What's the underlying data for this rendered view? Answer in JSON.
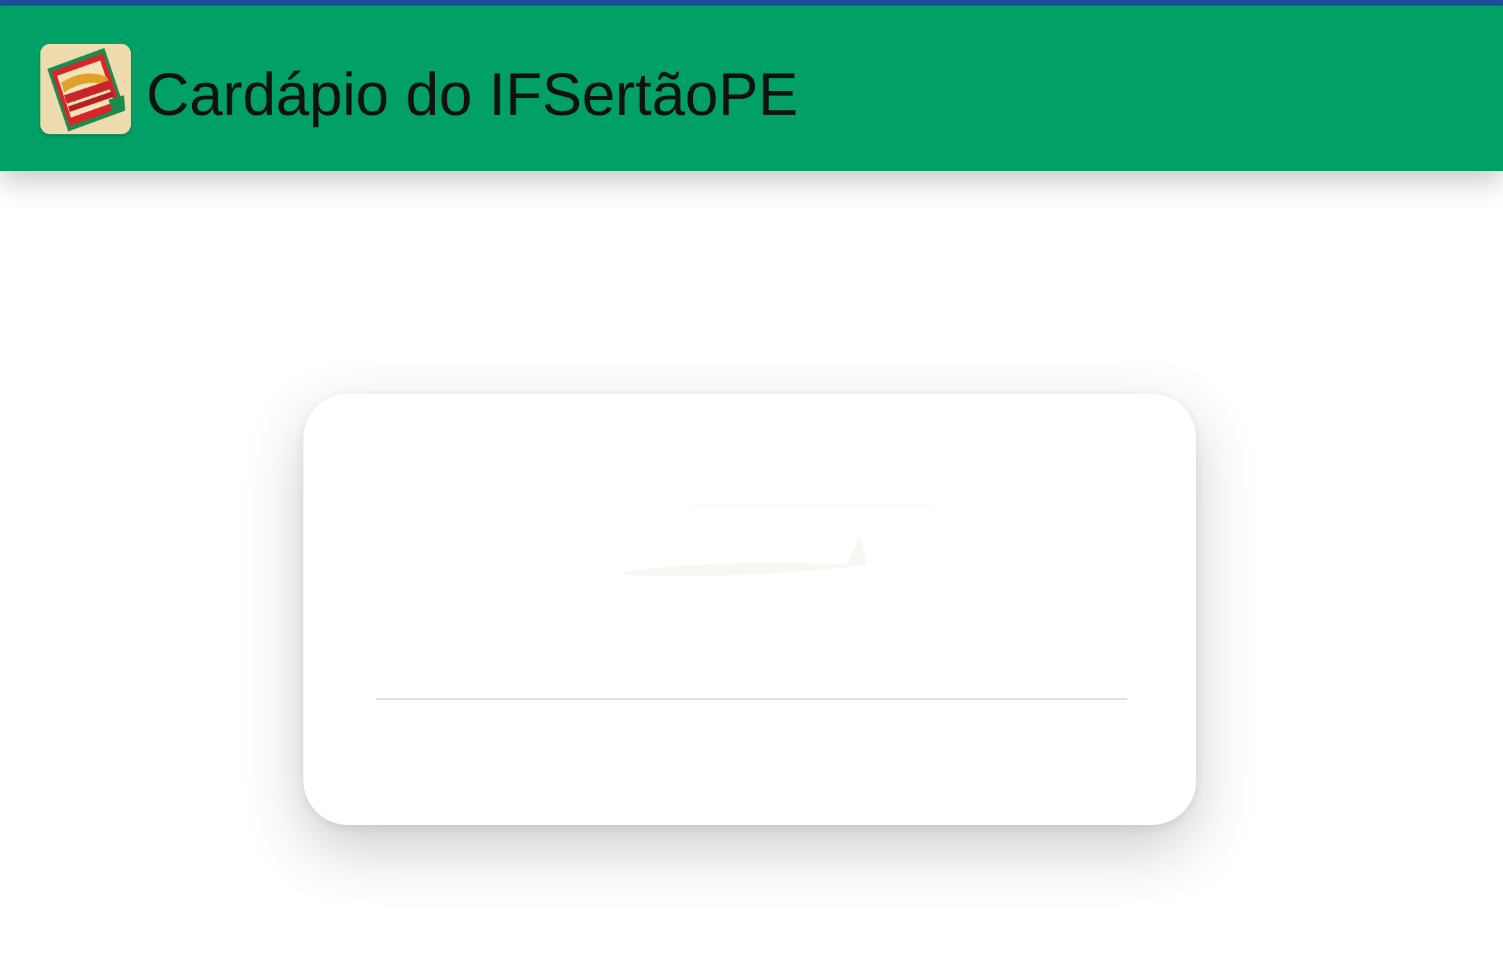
{
  "app_bar": {
    "title": "Cardápio do IFSertãoPE",
    "icon": "cardapio-menu-icon",
    "color": "#01a066"
  },
  "status_bar_color": "#1f4fa0",
  "card": {
    "logo": "faded-logo"
  }
}
